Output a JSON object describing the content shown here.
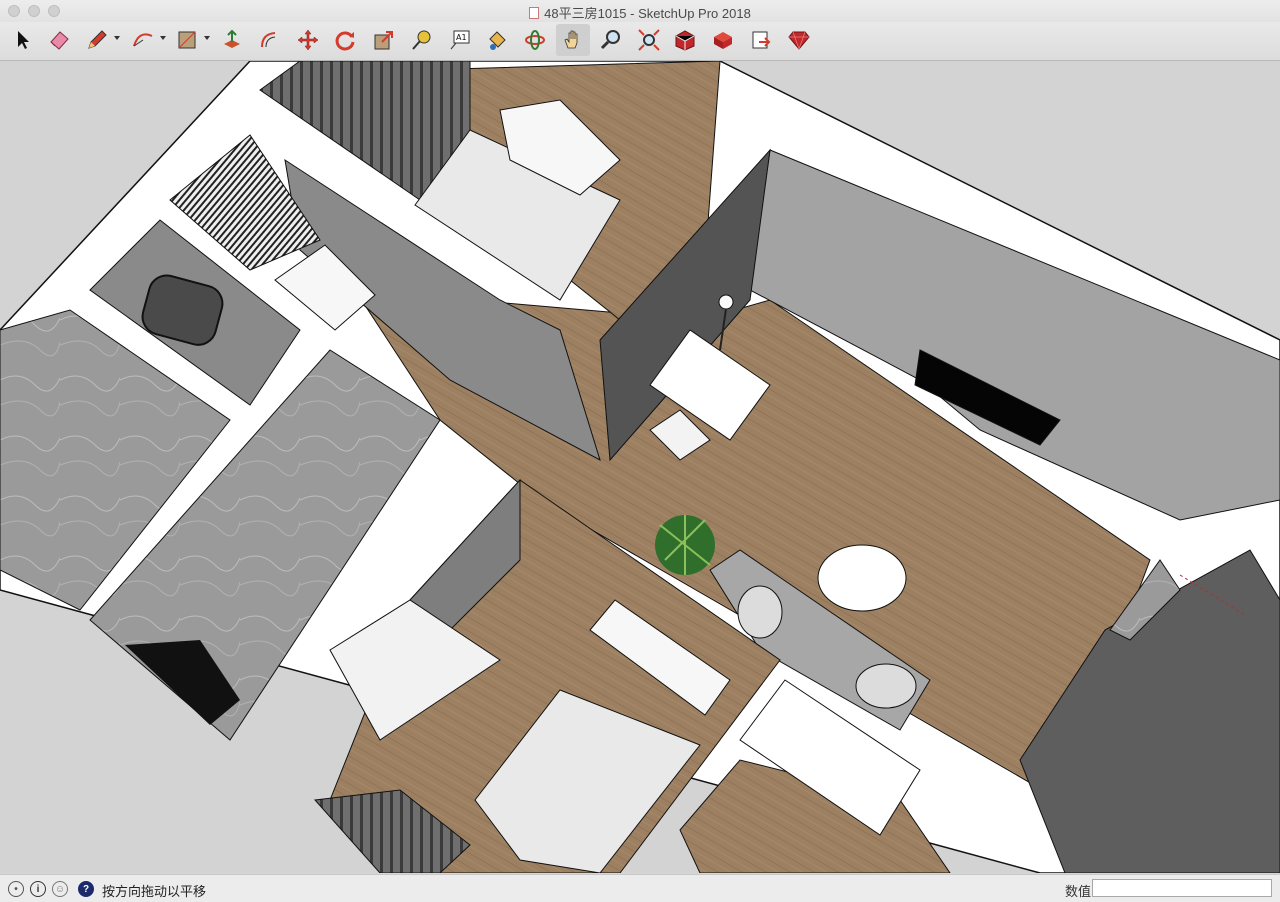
{
  "window": {
    "title": "48平三房1015 - SketchUp Pro 2018"
  },
  "toolbar": {
    "tools": [
      {
        "name": "select-tool",
        "icon": "arrow-cursor-icon"
      },
      {
        "name": "eraser-tool",
        "icon": "eraser-icon"
      },
      {
        "name": "line-tool",
        "icon": "pencil-icon",
        "has_menu": true
      },
      {
        "name": "arc-tool",
        "icon": "arc-icon",
        "has_menu": true
      },
      {
        "name": "rectangle-tool",
        "icon": "rectangle-icon",
        "has_menu": true
      },
      {
        "name": "push-pull-tool",
        "icon": "push-pull-icon"
      },
      {
        "name": "offset-tool",
        "icon": "offset-icon"
      },
      {
        "name": "move-tool",
        "icon": "move-icon"
      },
      {
        "name": "rotate-tool",
        "icon": "rotate-icon"
      },
      {
        "name": "scale-tool",
        "icon": "scale-icon"
      },
      {
        "name": "tape-measure-tool",
        "icon": "tape-measure-icon"
      },
      {
        "name": "text-tool",
        "icon": "text-icon",
        "label": "A1"
      },
      {
        "name": "paint-bucket-tool",
        "icon": "paint-bucket-icon"
      },
      {
        "name": "orbit-tool",
        "icon": "orbit-icon"
      },
      {
        "name": "pan-tool",
        "icon": "hand-icon",
        "active": true
      },
      {
        "name": "zoom-tool",
        "icon": "zoom-icon"
      },
      {
        "name": "zoom-extents-tool",
        "icon": "zoom-extents-icon"
      },
      {
        "name": "3d-warehouse-tool",
        "icon": "warehouse-icon"
      },
      {
        "name": "extension-warehouse-tool",
        "icon": "extension-warehouse-icon"
      },
      {
        "name": "share-model-tool",
        "icon": "share-model-icon"
      },
      {
        "name": "extension-manager-tool",
        "icon": "ruby-icon"
      }
    ]
  },
  "status": {
    "hint": "按方向拖动以平移",
    "measurements_label": "数值",
    "measurements_value": ""
  },
  "colors": {
    "wall_top": "#ffffff",
    "wall_side": "#8e8e8e",
    "floor_wood": "#9c8061",
    "tile": "#a7a7a7",
    "background": "#d3d3d3",
    "accent_red": "#c0282b"
  }
}
